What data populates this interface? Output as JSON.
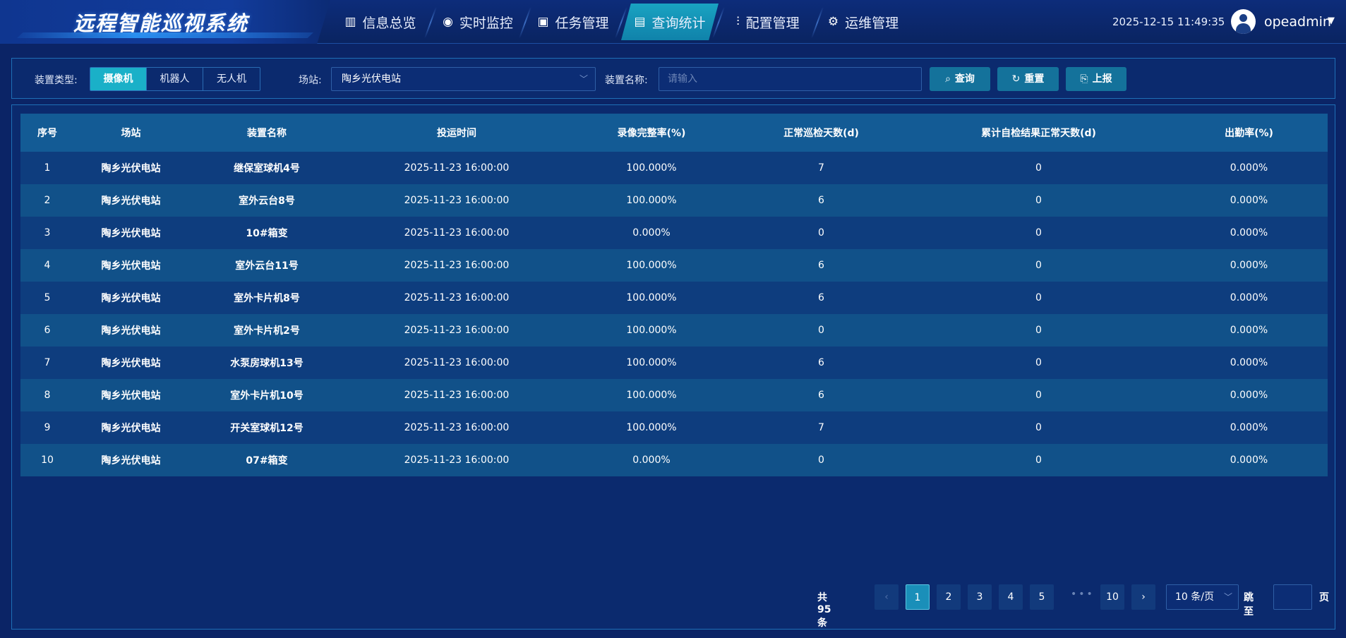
{
  "app": {
    "title": "远程智能巡视系统",
    "datetime": "2025-12-15 11:49:35",
    "username": "opeadmin"
  },
  "nav": [
    {
      "label": "信息总览",
      "icon": "chart-icon",
      "glyph": "▥",
      "active": false
    },
    {
      "label": "实时监控",
      "icon": "camera-icon",
      "glyph": "◉",
      "active": false
    },
    {
      "label": "任务管理",
      "icon": "task-icon",
      "glyph": "▣",
      "active": false
    },
    {
      "label": "查询统计",
      "icon": "stats-icon",
      "glyph": "▤",
      "active": true
    },
    {
      "label": "配置管理",
      "icon": "sliders-icon",
      "glyph": "⫶",
      "active": false
    },
    {
      "label": "运维管理",
      "icon": "gears-icon",
      "glyph": "⚙",
      "active": false
    }
  ],
  "filters": {
    "device_type_label": "装置类型:",
    "device_types": [
      "摄像机",
      "机器人",
      "无人机"
    ],
    "device_type_selected": "摄像机",
    "station_label": "场站:",
    "station_value": "陶乡光伏电站",
    "name_label": "装置名称:",
    "name_placeholder": "请输入",
    "search_label": "查询",
    "reset_label": "重置",
    "report_label": "上报"
  },
  "table": {
    "columns": [
      "序号",
      "场站",
      "装置名称",
      "投运时间",
      "录像完整率(%)",
      "正常巡检天数(d)",
      "累计自检结果正常天数(d)",
      "出勤率(%)"
    ],
    "rows": [
      [
        "1",
        "陶乡光伏电站",
        "继保室球机4号",
        "2025-11-23 16:00:00",
        "100.000%",
        "7",
        "0",
        "0.000%"
      ],
      [
        "2",
        "陶乡光伏电站",
        "室外云台8号",
        "2025-11-23 16:00:00",
        "100.000%",
        "6",
        "0",
        "0.000%"
      ],
      [
        "3",
        "陶乡光伏电站",
        "10#箱变",
        "2025-11-23 16:00:00",
        "0.000%",
        "0",
        "0",
        "0.000%"
      ],
      [
        "4",
        "陶乡光伏电站",
        "室外云台11号",
        "2025-11-23 16:00:00",
        "100.000%",
        "6",
        "0",
        "0.000%"
      ],
      [
        "5",
        "陶乡光伏电站",
        "室外卡片机8号",
        "2025-11-23 16:00:00",
        "100.000%",
        "6",
        "0",
        "0.000%"
      ],
      [
        "6",
        "陶乡光伏电站",
        "室外卡片机2号",
        "2025-11-23 16:00:00",
        "100.000%",
        "0",
        "0",
        "0.000%"
      ],
      [
        "7",
        "陶乡光伏电站",
        "水泵房球机13号",
        "2025-11-23 16:00:00",
        "100.000%",
        "6",
        "0",
        "0.000%"
      ],
      [
        "8",
        "陶乡光伏电站",
        "室外卡片机10号",
        "2025-11-23 16:00:00",
        "100.000%",
        "6",
        "0",
        "0.000%"
      ],
      [
        "9",
        "陶乡光伏电站",
        "开关室球机12号",
        "2025-11-23 16:00:00",
        "100.000%",
        "7",
        "0",
        "0.000%"
      ],
      [
        "10",
        "陶乡光伏电站",
        "07#箱变",
        "2025-11-23 16:00:00",
        "0.000%",
        "0",
        "0",
        "0.000%"
      ]
    ]
  },
  "pagination": {
    "total_text": "共 95 条",
    "pages": [
      "1",
      "2",
      "3",
      "4",
      "5"
    ],
    "last_page": "10",
    "current": "1",
    "dots": "•••",
    "prev": "‹",
    "next": "›",
    "page_size": "10 条/页",
    "jump_label": "跳至",
    "page_label": "页"
  },
  "colors": {
    "background": "#0b2466",
    "accent": "#1ab0c8",
    "header_row": "#135b95",
    "row_odd": "#0e3d7e",
    "row_even": "#115189"
  }
}
